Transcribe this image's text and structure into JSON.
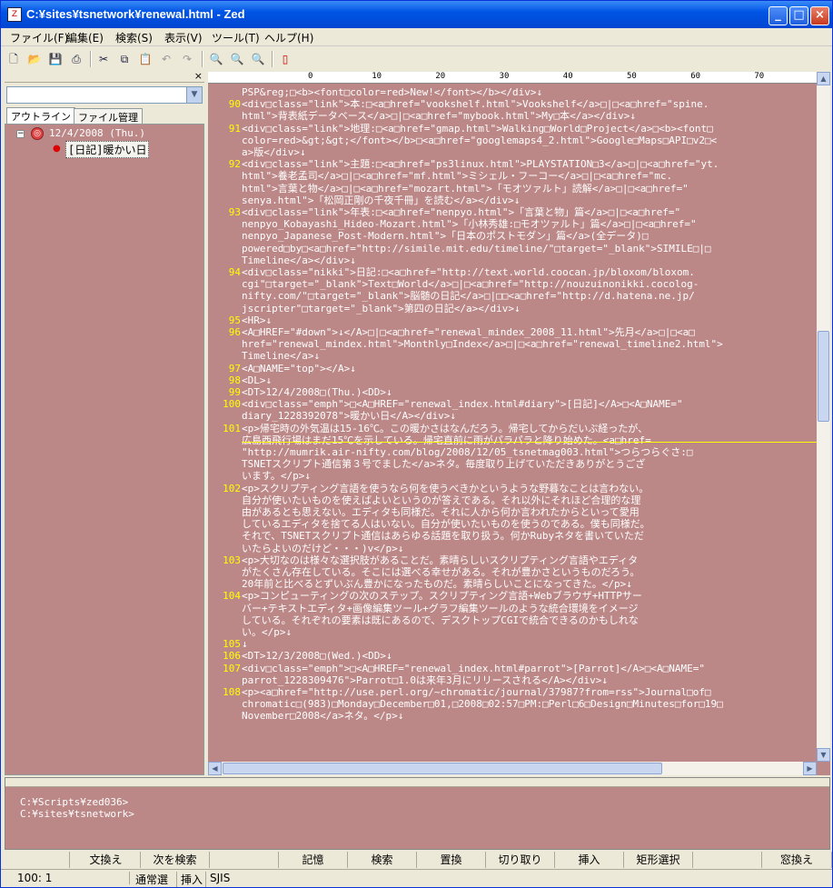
{
  "window": {
    "title": "C:¥sites¥tsnetwork¥renewal.html - Zed",
    "min": "_",
    "max": "□",
    "close": "×"
  },
  "menu": [
    "ファイル(F)",
    "編集(E)",
    "検索(S)",
    "表示(V)",
    "ツール(T)",
    "ヘルプ(H)"
  ],
  "toolbar_icons": [
    "new-icon",
    "open-icon",
    "save-icon",
    "print-icon",
    "cut-icon",
    "copy-icon",
    "paste-icon",
    "undo-icon",
    "redo-icon",
    "search-icon",
    "search-next-icon",
    "search-prev-icon",
    "bookmark-icon"
  ],
  "left": {
    "close": "×",
    "tabs": [
      "アウトライン",
      "ファイル管理"
    ],
    "tree": {
      "date": "12/4/2008 (Thu.)",
      "child": "[日記]暖かい日"
    }
  },
  "ruler": [
    "0",
    "10",
    "20",
    "30",
    "40",
    "50",
    "60",
    "70",
    "80"
  ],
  "lines": [
    {
      "n": "",
      "t": "PSP&reg;□<b><font□color=red>New!</font></b></div>↓"
    },
    {
      "n": "90",
      "t": "<div□class=\"link\">本:□<a□href=\"vookshelf.html\">Vookshelf</a>□|□<a□href=\"spine."
    },
    {
      "n": "",
      "t": "html\">背表紙データベース</a>□|□<a□href=\"mybook.html\">My□本</a></div>↓"
    },
    {
      "n": "91",
      "t": "<div□class=\"link\">地理:□<a□href=\"gmap.html\">Walking□World□Project</a>□<b><font□"
    },
    {
      "n": "",
      "t": "color=red>&gt;&gt;</font></b>□<a□href=\"googlemaps4_2.html\">Google□Maps□API□v2□<"
    },
    {
      "n": "",
      "t": "a>版</div>↓"
    },
    {
      "n": "92",
      "t": "<div□class=\"link\">主題:□<a□href=\"ps3linux.html\">PLAYSTATION□3</a>□|□<a□href=\"yt."
    },
    {
      "n": "",
      "t": "html\">養老孟司</a>□|□<a□href=\"mf.html\">ミシェル・フーコー</a>□|□<a□href=\"mc."
    },
    {
      "n": "",
      "t": "html\">言葉と物</a>□|□<a□href=\"mozart.html\">「モオツァルト」読解</a>□|□<a□href=\""
    },
    {
      "n": "",
      "t": "senya.html\">「松岡正剛の千夜千冊」を読む</a></div>↓"
    },
    {
      "n": "93",
      "t": "<div□class=\"link\">年表:□<a□href=\"nenpyo.html\">「言葉と物」篇</a>□|□<a□href=\""
    },
    {
      "n": "",
      "t": "nenpyo_Kobayashi_Hideo-Mozart.html\">「小林秀雄:□モオツァルト」篇</a>□|□<a□href=\""
    },
    {
      "n": "",
      "t": "nenpyo_Japanese_Post-Modern.html\">「日本のポストモダン」篇</a>(全データ)□"
    },
    {
      "n": "",
      "t": "powered□by□<a□href=\"http://simile.mit.edu/timeline/\"□target=\"_blank\">SIMILE□|□"
    },
    {
      "n": "",
      "t": "Timeline</a></div>↓"
    },
    {
      "n": "94",
      "t": "<div□class=\"nikki\">日記:□<a□href=\"http://text.world.coocan.jp/bloxom/bloxom."
    },
    {
      "n": "",
      "t": "cgi\"□target=\"_blank\">Text□World</a>□|□<a□href=\"http://nouzuinonikki.cocolog-"
    },
    {
      "n": "",
      "t": "nifty.com/\"□target=\"_blank\">脳髄の日記</a>□|□□<a□href=\"http://d.hatena.ne.jp/"
    },
    {
      "n": "",
      "t": "jscripter\"□target=\"_blank\">第四の日記</a></div>↓"
    },
    {
      "n": "95",
      "t": "<HR>↓"
    },
    {
      "n": "96",
      "t": "<A□HREF=\"#down\">↓</A>□|□<a□href=\"renewal_mindex_2008_11.html\">先月</a>□|□<a□"
    },
    {
      "n": "",
      "t": "href=\"renewal_mindex.html\">Monthly□Index</a>□|□<a□href=\"renewal_timeline2.html\">"
    },
    {
      "n": "",
      "t": "Timeline</a>↓"
    },
    {
      "n": "97",
      "t": "<A□NAME=\"top\"></A>↓"
    },
    {
      "n": "98",
      "t": "<DL>↓"
    },
    {
      "n": "99",
      "t": "<DT>12/4/2008□(Thu.)<DD>↓"
    },
    {
      "n": "100",
      "t": "<div□class=\"emph\">□<A□HREF=\"renewal_index.html#diary\">[日記]</A>□<A□NAME=\""
    },
    {
      "n": "",
      "t": "diary_1228392078\">暖かい日</A></div>↓"
    },
    {
      "n": "101",
      "t": "<p>帰宅時の外気温は15-16℃。この暖かさはなんだろう。帰宅してからだいぶ経ったが、"
    },
    {
      "n": "",
      "t": "広島西飛行場はまだ15℃を示している。帰宅直前に雨がパラパラと降り始めた。<a□href="
    },
    {
      "n": "",
      "t": "\"http://mumrik.air-nifty.com/blog/2008/12/05_tsnetmag003.html\">つらつらぐさ:□"
    },
    {
      "n": "",
      "t": "TSNETスクリプト通信第３号でました</a>ネタ。毎度取り上げていただきありがとうござ"
    },
    {
      "n": "",
      "t": "います。</p>↓"
    },
    {
      "n": "102",
      "t": "<p>スクリプティング言語を使うなら何を使うべきかというような野暮なことは言わない。"
    },
    {
      "n": "",
      "t": "自分が使いたいものを使えばよいというのが答えである。それ以外にそれほど合理的な理"
    },
    {
      "n": "",
      "t": "由があるとも思えない。エディタも同様だ。それに人から何か言われたからといって愛用"
    },
    {
      "n": "",
      "t": "しているエディタを捨てる人はいない。自分が使いたいものを使うのである。僕も同様だ。"
    },
    {
      "n": "",
      "t": "それで、TSNETスクリプト通信はあらゆる話題を取り扱う。何かRubyネタを書いていただ"
    },
    {
      "n": "",
      "t": "いたらよいのだけど・・・)v</p>↓"
    },
    {
      "n": "103",
      "t": "<p>大切なのは様々な選択肢があることだ。素晴らしいスクリプティング言語やエディタ"
    },
    {
      "n": "",
      "t": "がたくさん存在している。そこには選べる幸せがある。それが豊かさというものだろう。"
    },
    {
      "n": "",
      "t": "20年前と比べるとずいぶん豊かになったものだ。素晴らしいことになってきた。</p>↓"
    },
    {
      "n": "104",
      "t": "<p>コンピューティングの次のステップ。スクリプティング言語+Webブラウザ+HTTPサー"
    },
    {
      "n": "",
      "t": "バー+テキストエディタ+画像編集ツール+グラフ編集ツールのような統合環境をイメージ"
    },
    {
      "n": "",
      "t": "している。それぞれの要素は既にあるので、デスクトップCGIで統合できるのかもしれな"
    },
    {
      "n": "",
      "t": "い。</p>↓"
    },
    {
      "n": "105",
      "t": "↓"
    },
    {
      "n": "106",
      "t": "<DT>12/3/2008□(Wed.)<DD>↓"
    },
    {
      "n": "107",
      "t": "<div□class=\"emph\">□<A□HREF=\"renewal_index.html#parrot\">[Parrot]</A>□<A□NAME=\""
    },
    {
      "n": "",
      "t": "parrot_1228309476\">Parrot□1.0は来年3月にリリースされる</A></div>↓"
    },
    {
      "n": "108",
      "t": "<p><a□href=\"http://use.perl.org/~chromatic/journal/37987?from=rss\">Journal□of□"
    },
    {
      "n": "",
      "t": "chromatic□(983)□Monday□December□01,□2008□02:57□PM:□Perl□6□Design□Minutes□for□19□"
    },
    {
      "n": "",
      "t": "November□2008</a>ネタ。</p>↓"
    }
  ],
  "console": {
    "close": "×",
    "lines": [
      "C:¥Scripts¥zed036>",
      "C:¥sites¥tsnetwork>"
    ]
  },
  "fkeys": [
    "",
    "文換え",
    "次を検索",
    "",
    "記憶",
    "検索",
    "置換",
    "切り取り",
    "挿入",
    "矩形選択",
    "",
    "窓換え"
  ],
  "status": {
    "pos": "100:  1",
    "mode": "通常選",
    "ins": "挿入",
    "enc": "SJIS"
  }
}
